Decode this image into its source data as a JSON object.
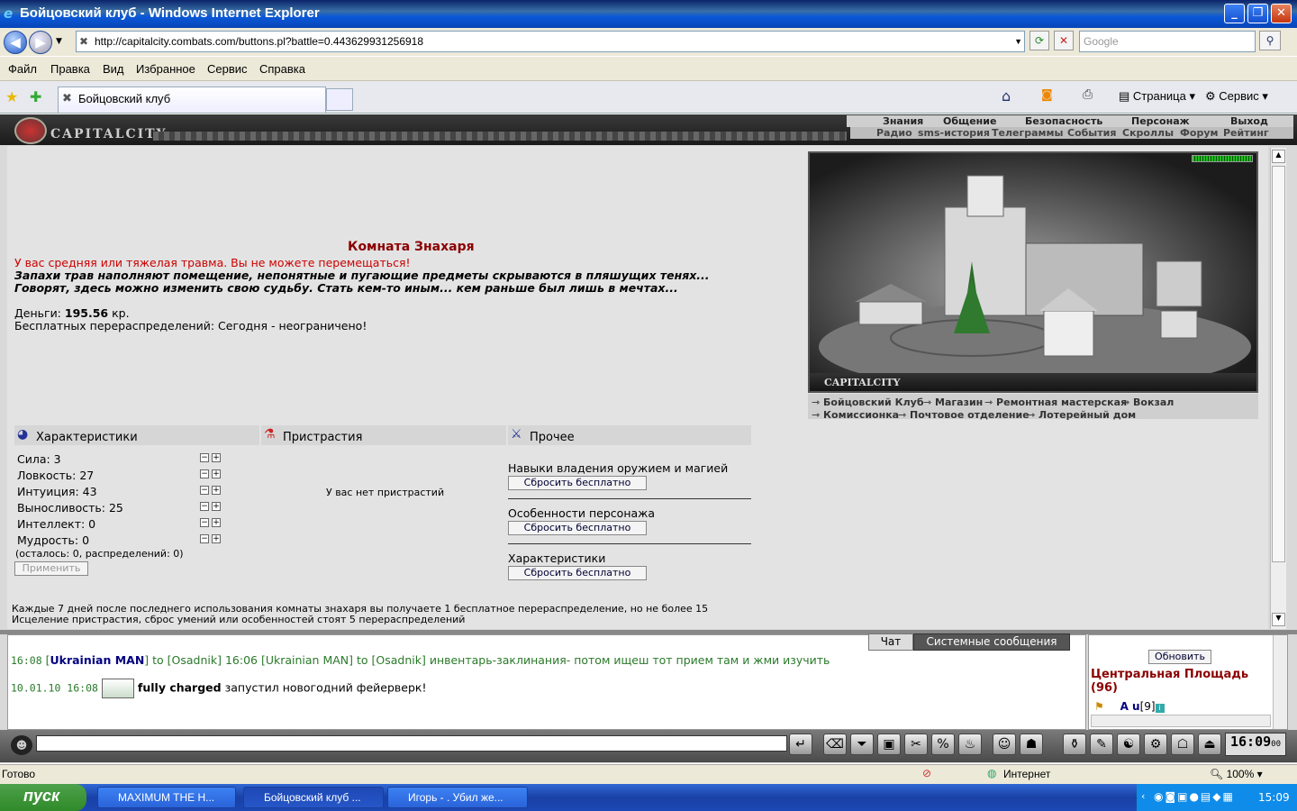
{
  "window": {
    "title": "Бойцовский клуб - Windows Internet Explorer"
  },
  "browser": {
    "url": "http://capitalcity.combats.com/buttons.pl?battle=0.443629931256918",
    "search_placeholder": "Google",
    "menu": [
      "Файл",
      "Правка",
      "Вид",
      "Избранное",
      "Сервис",
      "Справка"
    ],
    "tab_title": "Бойцовский клуб",
    "page_btn": "Страница",
    "tools_btn": "Сервис"
  },
  "game": {
    "logo": "CAPITALCITY",
    "nav_top": [
      "Знания",
      "Общение",
      "Безопасность",
      "Персонаж",
      "Выход"
    ],
    "nav_sub": [
      "Радио",
      "sms-история",
      "Телеграммы",
      "События",
      "Скроллы",
      "Форум",
      "Рейтинг"
    ],
    "room_title": "Комната Знахаря",
    "injury_msg": "У вас средняя или тяжелая травма. Вы не можете перемещаться!",
    "desc1": "Запахи трав наполняют помещение, непонятные и пугающие предметы скрываются в пляшущих тенях...",
    "desc2": "Говорят, здесь можно изменить свою судьбу. Стать кем-то иным... кем раньше был лишь в мечтах...",
    "money_label": "Деньги:",
    "money_value": "195.56",
    "money_unit": "кр.",
    "free_redistrib": "Бесплатных перераспределений: Сегодня - неограничено!",
    "sections": {
      "stats": "Характеристики",
      "addictions": "Пристрастия",
      "other": "Прочее"
    },
    "stats": [
      "Сила: 3",
      "Ловкость: 27",
      "Интуиция: 43",
      "Выносливость: 25",
      "Интеллект: 0",
      "Мудрость: 0"
    ],
    "stats_remaining": "(осталось: 0, распределений: 0)",
    "apply_btn": "Применить",
    "no_addictions": "У вас нет пристрастий",
    "other_items": [
      "Навыки владения оружием и магией",
      "Особенности персонажа",
      "Характеристики"
    ],
    "reset_btn": "Сбросить бесплатно",
    "footer1": "Каждые 7 дней после последнего использования комнаты знахаря вы получаете 1 бесплатное перераспределение, но не более 15",
    "footer2": "Исцеление пристрастия, сброс умений или особенностей стоят 5 перераспределений",
    "city_caption": "CAPITALCITY",
    "locations_row1": [
      "Бойцовский Клуб",
      "Магазин",
      "Ремонтная мастерская",
      "Вокзал"
    ],
    "locations_row2": [
      "Комиссионка",
      "Почтовое отделение",
      "Лотерейный дом"
    ]
  },
  "chat": {
    "tabs": [
      "Чат",
      "Системные сообщения"
    ],
    "line1_time": "16:08",
    "line1_from": "Ukrainian MAN",
    "line1_text": "to [Osadnik] 16:06 [Ukrainian MAN] to [Osadnik] инвентарь-заклинания- потом ищеш тот прием там и жми изучить",
    "line2_time": "10.01.10 16:08",
    "line2_name": "fully charged",
    "line2_text": "запустил новогодний фейерверк!",
    "refresh_btn": "Обновить",
    "location": "Центральная Площадь (96)",
    "user": "A u",
    "user_level": "[9]",
    "clock": "16:09",
    "clock_sec": "00"
  },
  "status": {
    "left": "Готово",
    "zone": "Интернет",
    "zoom": "100%"
  },
  "taskbar": {
    "start": "пуск",
    "tasks": [
      "MAXIMUM THE H...",
      "Бойцовский клуб ...",
      "Игорь - . Убил же..."
    ],
    "time": "15:09"
  },
  "colors": {
    "accent": "#8b0000",
    "chat_green": "#2a7a2a",
    "name_blue": "#000080"
  }
}
